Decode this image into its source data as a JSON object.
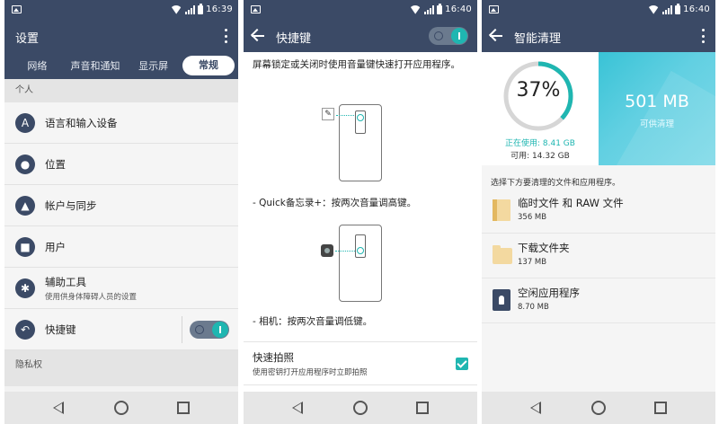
{
  "status": {
    "panel1_time": "16:39",
    "panel2_time": "16:40",
    "panel3_time": "16:40"
  },
  "settings": {
    "title": "设置",
    "tabs": [
      "网络",
      "声音和通知",
      "显示屏",
      "常规"
    ],
    "section_personal": "个人",
    "items": [
      {
        "label": "语言和输入设备",
        "icon": "language-icon"
      },
      {
        "label": "位置",
        "icon": "location-icon"
      },
      {
        "label": "帐户与同步",
        "icon": "account-sync-icon"
      },
      {
        "label": "用户",
        "icon": "user-icon"
      },
      {
        "label": "辅助工具",
        "sublabel": "使用供身体障碍人员的设置",
        "icon": "accessibility-icon"
      },
      {
        "label": "快捷键",
        "icon": "shortcut-icon",
        "toggle": true
      }
    ],
    "section_privacy": "隐私权"
  },
  "shortcut": {
    "title": "快捷键",
    "toggle_on": true,
    "description": "屏幕锁定或关闭时使用音量键快速打开应用程序。",
    "memo_caption": "- Quick备忘录+：按两次音量调高键。",
    "camera_caption": "- 相机：按两次音量调低键。",
    "quick_shot_title": "快速拍照",
    "quick_shot_sub": "使用密钥打开应用程序时立即拍照",
    "quick_shot_checked": true
  },
  "cleanup": {
    "title": "智能清理",
    "percent_label": "37%",
    "percent_value": 37,
    "in_use": "正在使用: 8.41 GB",
    "available": "可用: 14.32 GB",
    "junk_size": "501 MB",
    "junk_label": "可供清理",
    "hint": "选择下方要清理的文件和应用程序。",
    "items": [
      {
        "name": "临时文件 和 RAW 文件",
        "size": "356 MB",
        "icon": "temp-file-icon"
      },
      {
        "name": "下载文件夹",
        "size": "137 MB",
        "icon": "folder-icon"
      },
      {
        "name": "空闲应用程序",
        "size": "8.70 MB",
        "icon": "idle-app-icon"
      }
    ]
  },
  "colors": {
    "header": "#3b4a66",
    "accent": "#1fb6b1"
  }
}
